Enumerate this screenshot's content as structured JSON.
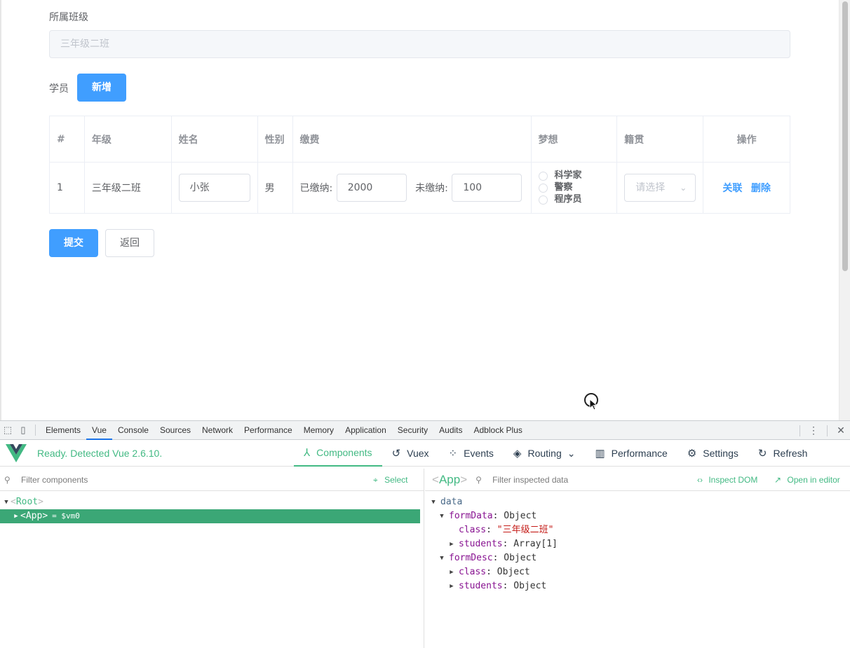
{
  "form": {
    "class_label": "所属班级",
    "class_value": "三年级二班",
    "students_label": "学员",
    "add_button": "新增",
    "submit_button": "提交",
    "back_button": "返回"
  },
  "table": {
    "headers": [
      "#",
      "年级",
      "姓名",
      "性别",
      "缴费",
      "梦想",
      "籍贯",
      "操作"
    ],
    "rows": [
      {
        "index": "1",
        "grade": "三年级二班",
        "name": "小张",
        "gender": "男",
        "paid_label": "已缴纳:",
        "paid_value": "2000",
        "unpaid_label": "未缴纳:",
        "unpaid_value": "100",
        "dreams": [
          "科学家",
          "警察",
          "程序员"
        ],
        "origin_placeholder": "请选择",
        "actions": [
          "关联",
          "删除"
        ]
      }
    ]
  },
  "devtools": {
    "tabs": [
      "Elements",
      "Vue",
      "Console",
      "Sources",
      "Network",
      "Performance",
      "Memory",
      "Application",
      "Security",
      "Audits",
      "Adblock Plus"
    ],
    "active_tab": "Vue",
    "vue": {
      "status": "Ready. Detected Vue 2.6.10.",
      "nav": [
        {
          "label": "Components",
          "icon": "components-icon",
          "glyph": "⅄"
        },
        {
          "label": "Vuex",
          "icon": "history-icon",
          "glyph": "↺"
        },
        {
          "label": "Events",
          "icon": "events-icon",
          "glyph": "⁘"
        },
        {
          "label": "Routing",
          "icon": "routing-icon",
          "glyph": "◈"
        },
        {
          "label": "Performance",
          "icon": "performance-icon",
          "glyph": "▥"
        },
        {
          "label": "Settings",
          "icon": "settings-icon",
          "glyph": "⚙"
        },
        {
          "label": "Refresh",
          "icon": "refresh-icon",
          "glyph": "↻"
        }
      ],
      "routing_caret": "⌄",
      "filter_components_placeholder": "Filter components",
      "select_label": "Select",
      "tree": {
        "root": "Root",
        "app": "App",
        "app_suffix": "= $vm0"
      },
      "inspect": {
        "component": "App",
        "filter_placeholder": "Filter inspected data",
        "inspect_dom": "Inspect DOM",
        "open_in_editor": "Open in editor",
        "section": "data",
        "formData_key": "formData",
        "formData_type": "Object",
        "class_key": "class",
        "class_value": "\"三年级二班\"",
        "students_key": "students",
        "students_type": "Array[1]",
        "formDesc_key": "formDesc",
        "formDesc_type": "Object",
        "desc_class_key": "class",
        "desc_class_type": "Object",
        "desc_students_key": "students",
        "desc_students_type": "Object"
      }
    }
  },
  "colors": {
    "primary": "#409eff",
    "vue_green": "#42b983",
    "selected_row": "#3ba776"
  }
}
